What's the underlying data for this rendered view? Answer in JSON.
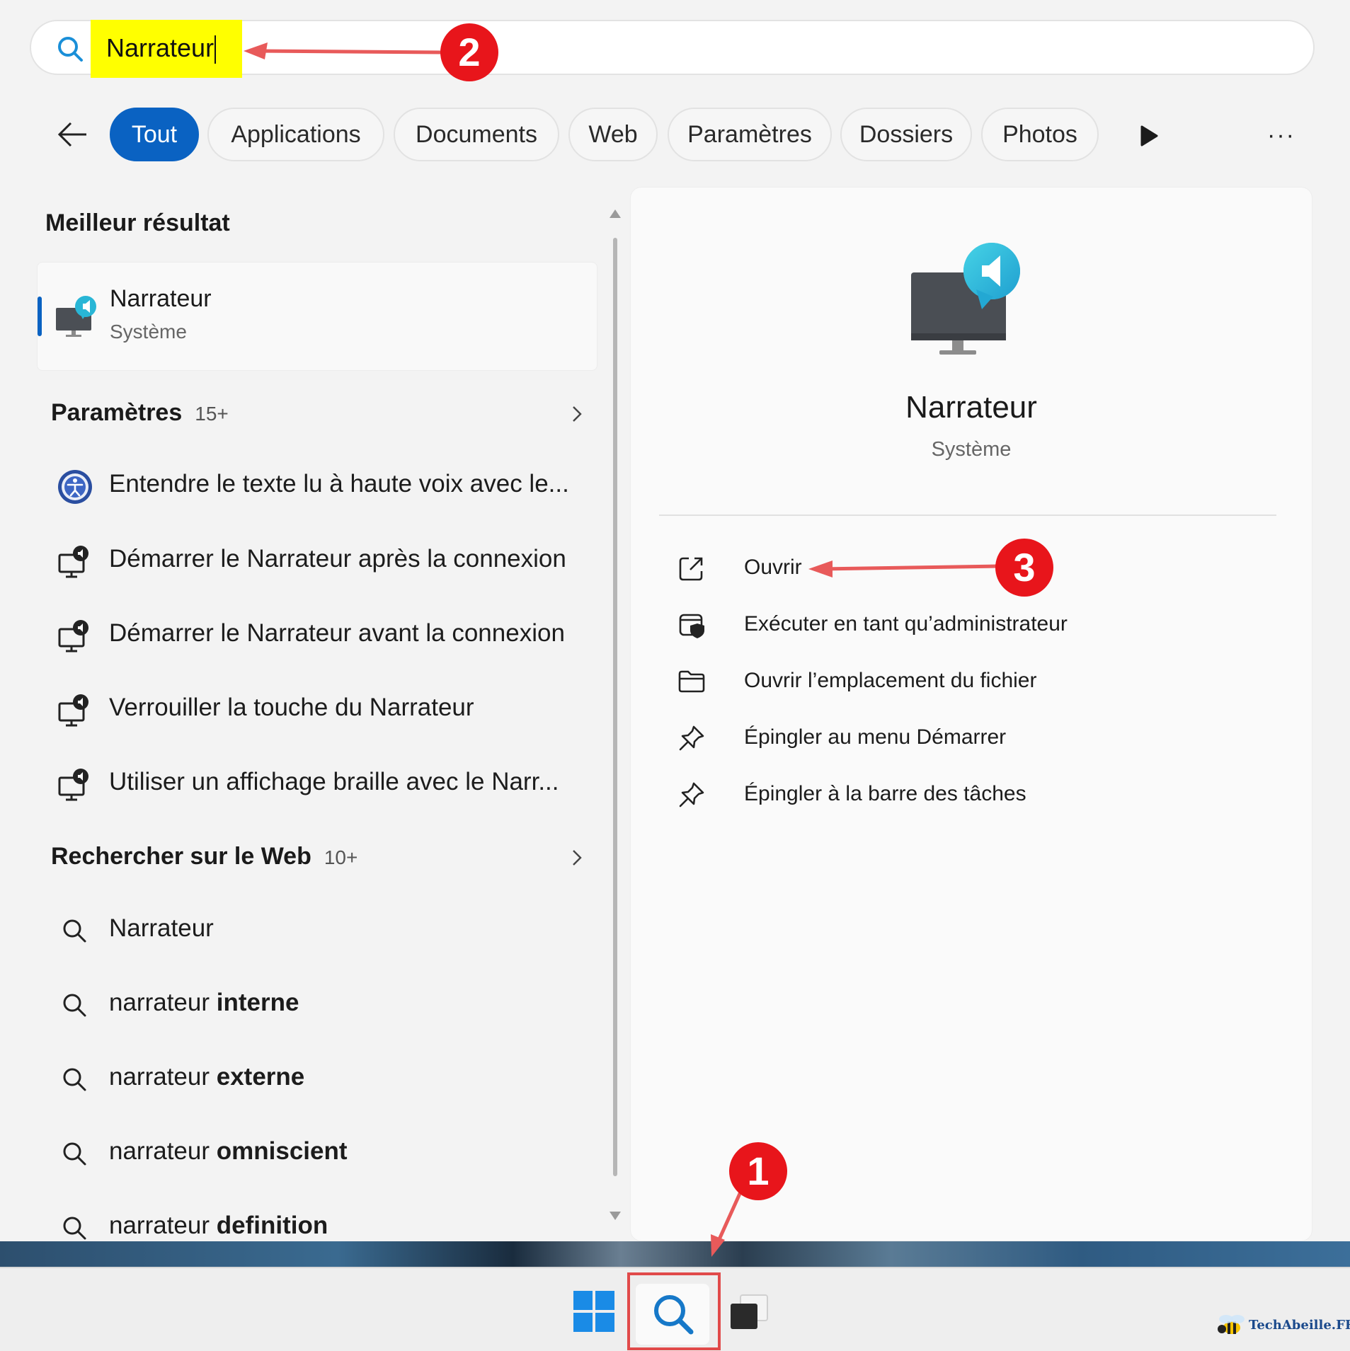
{
  "search": {
    "query": "Narrateur"
  },
  "filters": {
    "tabs": [
      {
        "label": "Tout",
        "active": true
      },
      {
        "label": "Applications"
      },
      {
        "label": "Documents"
      },
      {
        "label": "Web"
      },
      {
        "label": "Paramètres"
      },
      {
        "label": "Dossiers"
      },
      {
        "label": "Photos"
      }
    ],
    "more_label": "···"
  },
  "best": {
    "title": "Meilleur résultat",
    "name": "Narrateur",
    "subtitle": "Système"
  },
  "settings": {
    "title": "Paramètres",
    "count": "15+",
    "items": [
      {
        "label": "Entendre le texte lu à haute voix avec le...",
        "icon": "accessibility-icon"
      },
      {
        "label": "Démarrer le Narrateur après la connexion",
        "icon": "narrator-settings-icon"
      },
      {
        "label": "Démarrer le Narrateur avant la connexion",
        "icon": "narrator-settings-icon"
      },
      {
        "label": "Verrouiller la touche du Narrateur",
        "icon": "narrator-settings-icon"
      },
      {
        "label": "Utiliser un affichage braille avec le Narr...",
        "icon": "narrator-settings-icon"
      }
    ]
  },
  "web": {
    "title": "Rechercher sur le Web",
    "count": "10+",
    "items": [
      {
        "prefix": "Narrateur",
        "bold": ""
      },
      {
        "prefix": "narrateur ",
        "bold": "interne"
      },
      {
        "prefix": "narrateur ",
        "bold": "externe"
      },
      {
        "prefix": "narrateur ",
        "bold": "omniscient"
      },
      {
        "prefix": "narrateur ",
        "bold": "definition"
      }
    ]
  },
  "detail": {
    "name": "Narrateur",
    "subtitle": "Système",
    "actions": [
      {
        "label": "Ouvrir",
        "icon": "open-external-icon"
      },
      {
        "label": "Exécuter en tant qu’administrateur",
        "icon": "shield-icon"
      },
      {
        "label": "Ouvrir l’emplacement du fichier",
        "icon": "folder-icon"
      },
      {
        "label": "Épingler au menu Démarrer",
        "icon": "pin-icon"
      },
      {
        "label": "Épingler à la barre des tâches",
        "icon": "pin-icon"
      }
    ]
  },
  "annotations": {
    "steps": [
      "1",
      "2",
      "3"
    ],
    "accent_color": "#e8151b",
    "highlight_color": "#ffff00"
  },
  "colors": {
    "accent": "#0a62c2"
  },
  "watermark": {
    "text": "TechAbeille.FR"
  }
}
